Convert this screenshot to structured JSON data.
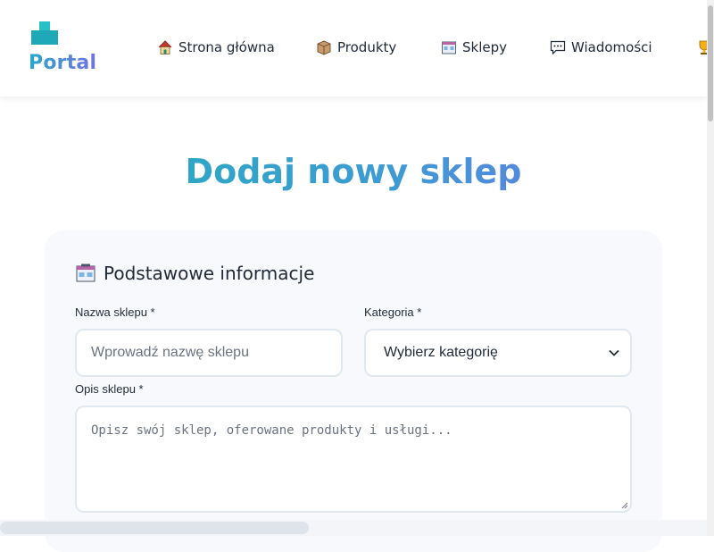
{
  "app": {
    "logo_text": "Portal"
  },
  "nav": {
    "items": [
      {
        "label": "Strona główna",
        "icon": "house-icon"
      },
      {
        "label": "Produkty",
        "icon": "package-icon"
      },
      {
        "label": "Sklepy",
        "icon": "store-icon"
      },
      {
        "label": "Wiadomości",
        "icon": "speech-bubble-icon"
      },
      {
        "label": "",
        "icon": "trophy-icon"
      }
    ]
  },
  "page": {
    "title": "Dodaj nowy sklep"
  },
  "form": {
    "section_title": "Podstawowe informacje",
    "section_icon": "store-icon",
    "name": {
      "label": "Nazwa sklepu *",
      "placeholder": "Wprowadź nazwę sklepu"
    },
    "category": {
      "label": "Kategoria *",
      "selected": "Wybierz kategorię"
    },
    "description": {
      "label": "Opis sklepu *",
      "placeholder": "Opisz swój sklep, oferowane produkty i usługi..."
    }
  },
  "colors": {
    "accent_start": "#21b1b9",
    "accent_end": "#7272e3",
    "card_bg": "#f7f9fc",
    "input_border": "#e2e8f0"
  }
}
